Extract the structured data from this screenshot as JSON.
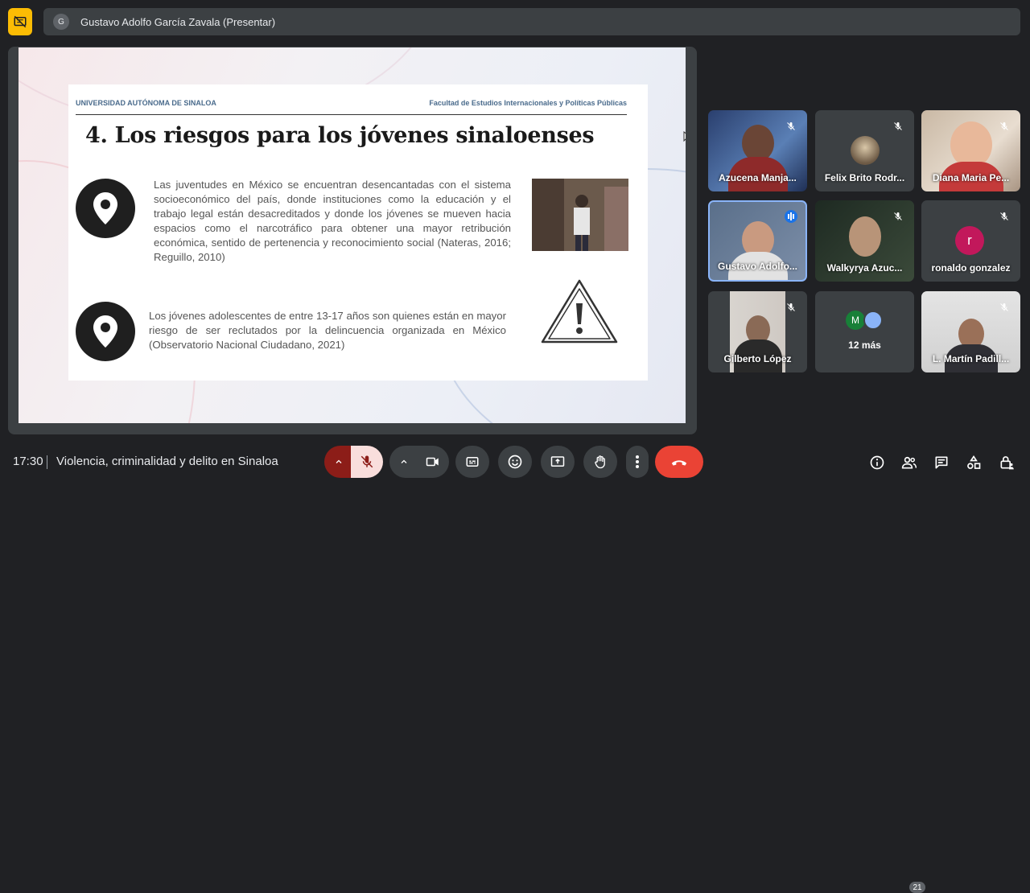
{
  "presenter": {
    "initial": "G",
    "title": "Gustavo Adolfo García Zavala (Presentar)"
  },
  "slide": {
    "university": "UNIVERSIDAD AUTÓNOMA DE SINALOA",
    "faculty": "Facultad de Estudios Internacionales y Políticas Públicas",
    "title": "4. Los riesgos para los jóvenes sinaloenses",
    "paragraph1": "Las juventudes en México se encuentran desencantadas con el sistema socioeconómico del país, donde instituciones como la educación y el trabajo legal están desacreditados y donde los jóvenes se mueven hacia espacios como el narcotráfico para obtener una mayor retribución económica, sentido de pertenencia y reconocimiento social (Nateras, 2016; Reguillo, 2010)",
    "paragraph2": "Los jóvenes adolescentes de entre 13-17 años son quienes están en mayor riesgo de ser reclutados por la delincuencia organizada en México (Observatorio Nacional Ciudadano, 2021)"
  },
  "participants": [
    {
      "name": "Azucena Manja..."
    },
    {
      "name": "Felix Brito Rodr..."
    },
    {
      "name": "Diana Maria Pe..."
    },
    {
      "name": "Gustavo Adolfo..."
    },
    {
      "name": "Walkyrya Azuc..."
    },
    {
      "name": "ronaldo gonzalez",
      "initial": "r"
    },
    {
      "name": "Gilberto López"
    },
    {
      "more_label": "12 más",
      "initial": "M"
    },
    {
      "name": "L. Martín Padill..."
    }
  ],
  "footer": {
    "time": "17:30",
    "meeting_title": "Violencia, criminalidad y delito en Sinaloa",
    "people_count": "21"
  },
  "colors": {
    "accent": "#fbbc04",
    "end_call": "#ea4335",
    "mic_off": "#f9dedc",
    "speaking": "#8ab4f8"
  }
}
